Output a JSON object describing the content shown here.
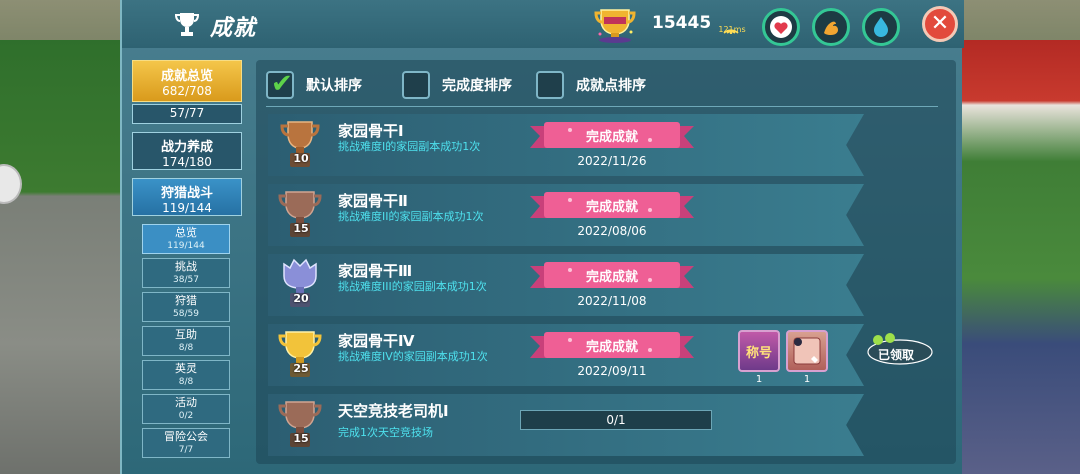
{
  "header": {
    "title": "成就",
    "score": "15445",
    "ping": "121ms",
    "close_label": "✕"
  },
  "categories": [
    {
      "label": "成就总览",
      "value": "682/708"
    },
    {
      "label": "",
      "value": "57/77"
    },
    {
      "label": "战力养成",
      "value": "174/180"
    },
    {
      "label": "狩猎战斗",
      "value": "119/144"
    }
  ],
  "subcategories": [
    {
      "label": "总览",
      "value": "119/144"
    },
    {
      "label": "挑战",
      "value": "38/57"
    },
    {
      "label": "狩猎",
      "value": "58/59"
    },
    {
      "label": "互助",
      "value": "8/8"
    },
    {
      "label": "英灵",
      "value": "8/8"
    },
    {
      "label": "活动",
      "value": "0/2"
    },
    {
      "label": "冒险公会",
      "value": "7/7"
    }
  ],
  "sort": {
    "default": "默认排序",
    "completion": "完成度排序",
    "points": "成就点排序"
  },
  "achievements": [
    {
      "name": "家园骨干Ⅰ",
      "level": "10",
      "desc": "挑战难度I的家园副本成功1次",
      "status": "完成成就",
      "date": "2022/11/26",
      "medal": "bronze"
    },
    {
      "name": "家园骨干Ⅱ",
      "level": "15",
      "desc": "挑战难度II的家园副本成功1次",
      "status": "完成成就",
      "date": "2022/08/06",
      "medal": "bronze"
    },
    {
      "name": "家园骨干Ⅲ",
      "level": "20",
      "desc": "挑战难度III的家园副本成功1次",
      "status": "完成成就",
      "date": "2022/11/08",
      "medal": "silver"
    },
    {
      "name": "家园骨干Ⅳ",
      "level": "25",
      "desc": "挑战难度IV的家园副本成功1次",
      "status": "完成成就",
      "date": "2022/09/11",
      "medal": "gold"
    },
    {
      "name": "天空竞技老司机Ⅰ",
      "level": "15",
      "desc": "完成1次天空竞技场",
      "progress": "0/1",
      "medal": "bronze"
    }
  ],
  "rewards": [
    {
      "label": "称号",
      "qty": "1"
    },
    {
      "label": "",
      "qty": "1"
    }
  ],
  "claimed_label": "已领取"
}
